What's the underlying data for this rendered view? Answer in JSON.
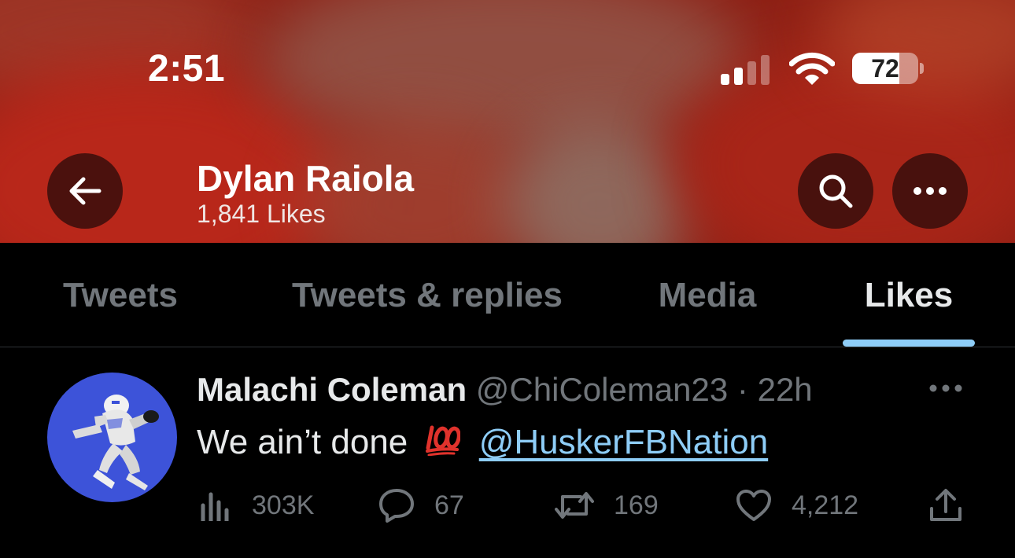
{
  "status_bar": {
    "time": "2:51",
    "battery_percent": "72",
    "battery_level": 0.72,
    "signal_bars_active": 2,
    "signal_bars_total": 4
  },
  "header": {
    "name": "Dylan Raiola",
    "likes_line": "1,841 Likes",
    "back_icon": "arrow-left-icon",
    "search_icon": "search-icon",
    "more_icon": "more-horizontal-icon"
  },
  "tabs": [
    {
      "label": "Tweets",
      "active": false
    },
    {
      "label": "Tweets & replies",
      "active": false
    },
    {
      "label": "Media",
      "active": false
    },
    {
      "label": "Likes",
      "active": true
    }
  ],
  "tweet": {
    "author_name": "Malachi Coleman",
    "author_handle": "@ChiColeman23",
    "separator": "·",
    "time": "22h",
    "text": "We ain’t done",
    "emoji": "💯",
    "mention": "@HuskerFBNation",
    "stats": {
      "views": "303K",
      "replies": "67",
      "retweets": "169",
      "likes": "4,212"
    }
  },
  "colors": {
    "background": "#000000",
    "accent": "#8ecdf7",
    "muted": "#71767b",
    "avatar_bg": "#3d53d9",
    "banner": "#8e1f14"
  }
}
